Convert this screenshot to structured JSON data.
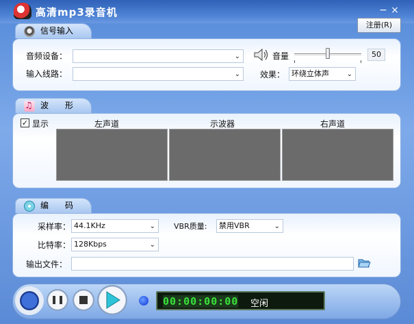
{
  "window": {
    "title": "高清mp3录音机",
    "minimize": "−",
    "close": "×"
  },
  "register_button": "注册(R)",
  "signal": {
    "tab": "信号输入",
    "device_label": "音频设备：",
    "device_value": "",
    "line_label": "输入线路：",
    "line_value": "",
    "volume_label": "音量",
    "volume_value": "50",
    "volume_level": 0.5,
    "effect_label": "效果：",
    "effect_value": "环绕立体声"
  },
  "waveform": {
    "tab": "波　　形",
    "show_label": "显示",
    "show_checked": true,
    "columns": [
      "左声道",
      "示波器",
      "右声道"
    ]
  },
  "encode": {
    "tab": "编　　码",
    "sample_label": "采样率：",
    "sample_value": "44.1KHz",
    "vbr_label": "VBR质量:",
    "vbr_value": "禁用VBR",
    "bitrate_label": "比特率：",
    "bitrate_value": "128Kbps",
    "output_label": "输出文件：",
    "output_value": ""
  },
  "status": {
    "timer": "00:00:00:00",
    "state": "空闲"
  },
  "colors": {
    "accent": "#4f84d6",
    "lcd_bg": "#0e1a0e",
    "lcd_text": "#39e339",
    "scope": "#6b6b6b"
  }
}
